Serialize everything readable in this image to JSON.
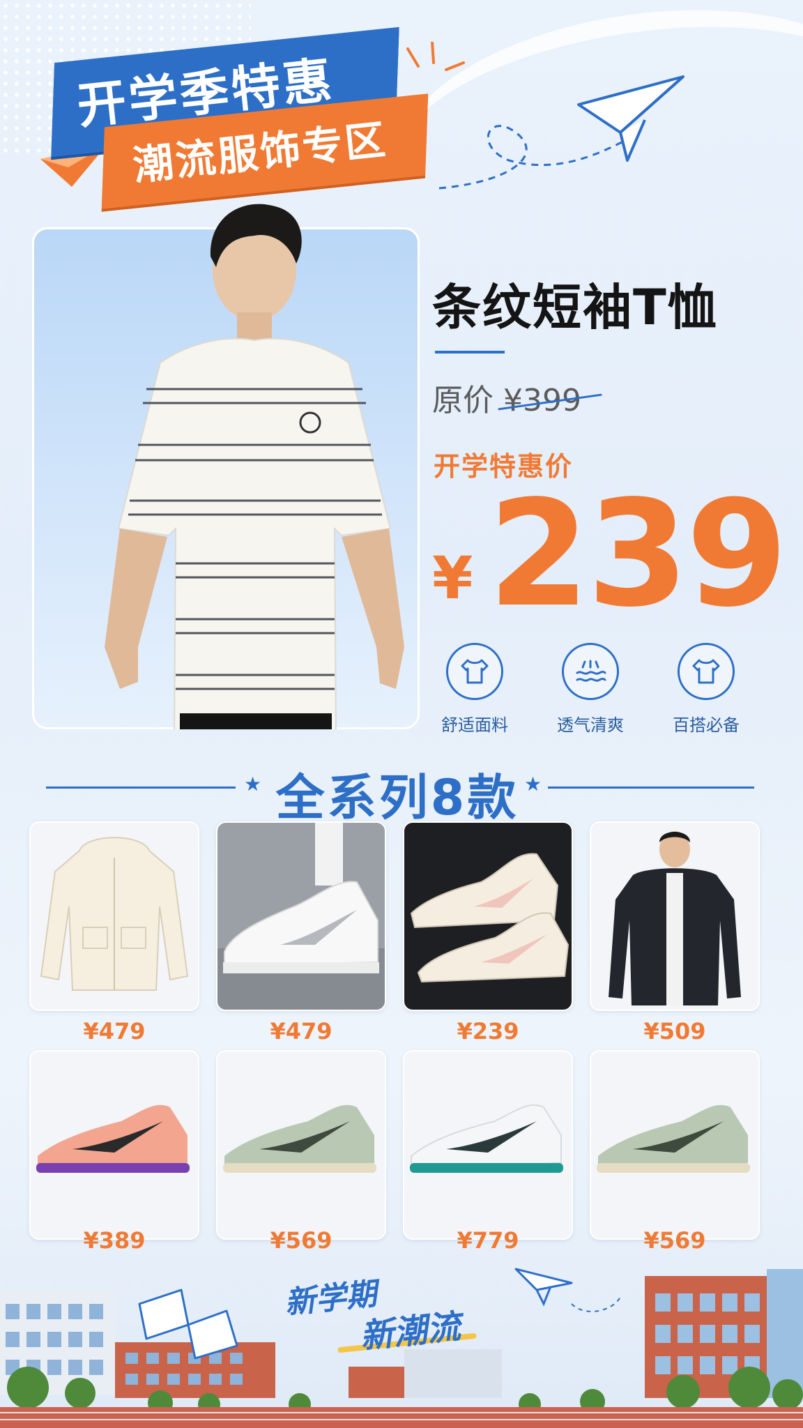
{
  "banner": {
    "line1": "开学季特惠",
    "line2": "潮流服饰专区"
  },
  "hero": {
    "product_name": "条纹短袖T恤",
    "original_label": "原价",
    "original_price": "¥399",
    "promo_label": "开学特惠价",
    "currency": "¥",
    "price": "239",
    "features": [
      {
        "label": "舒适面料",
        "icon": "tshirt-icon"
      },
      {
        "label": "透气清爽",
        "icon": "breathable-icon"
      },
      {
        "label": "百搭必备",
        "icon": "tshirt-icon"
      }
    ]
  },
  "section": {
    "title": "全系列8款"
  },
  "products": [
    {
      "price": "¥479",
      "item": "cream-hooded-jacket"
    },
    {
      "price": "¥479",
      "item": "white-sneaker"
    },
    {
      "price": "¥239",
      "item": "cream-sneakers"
    },
    {
      "price": "¥509",
      "item": "black-bomber-jacket"
    },
    {
      "price": "¥389",
      "item": "peach-running-shoes"
    },
    {
      "price": "¥569",
      "item": "sage-running-shoes"
    },
    {
      "price": "¥779",
      "item": "white-teal-running-shoes"
    },
    {
      "price": "¥569",
      "item": "sage-running-shoes"
    }
  ],
  "footer": {
    "slogan_line1": "新学期",
    "slogan_line2": "新潮流"
  },
  "colors": {
    "brand_blue": "#2d6fc7",
    "accent_orange": "#f07a34",
    "background": "#e4eefa"
  }
}
